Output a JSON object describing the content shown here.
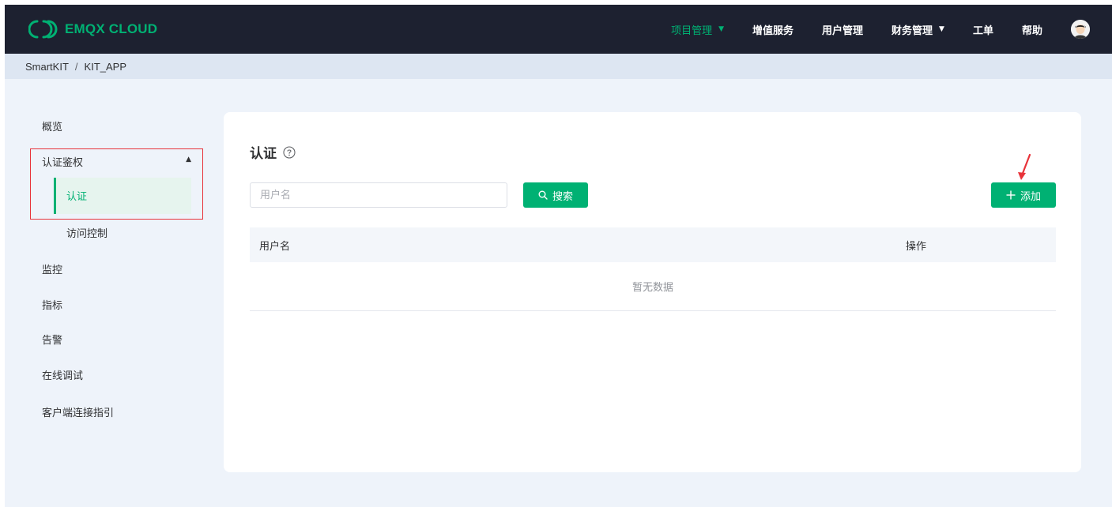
{
  "brand": {
    "name": "EMQX CLOUD",
    "color": "#00b173"
  },
  "nav": {
    "items": [
      {
        "label": "项目管理",
        "active": true,
        "dropdown": true
      },
      {
        "label": "增值服务",
        "active": false,
        "dropdown": false
      },
      {
        "label": "用户管理",
        "active": false,
        "dropdown": false
      },
      {
        "label": "财务管理",
        "active": false,
        "dropdown": true
      },
      {
        "label": "工单",
        "active": false,
        "dropdown": false
      },
      {
        "label": "帮助",
        "active": false,
        "dropdown": false
      }
    ],
    "avatar_icon": "user-avatar-icon"
  },
  "breadcrumb": {
    "project": "SmartKIT",
    "separator": "/",
    "app": "KIT_APP"
  },
  "sidebar": {
    "overview": "概览",
    "auth_group": {
      "label": "认证鉴权",
      "expanded": true,
      "children": [
        {
          "label": "认证",
          "active": true
        },
        {
          "label": "访问控制",
          "active": false
        }
      ]
    },
    "items": [
      "监控",
      "指标",
      "告警",
      "在线调试",
      "客户端连接指引"
    ]
  },
  "main": {
    "title": "认证",
    "help_icon": "question-circle-icon",
    "search": {
      "placeholder": "用户名",
      "value": "",
      "button_label": "搜索"
    },
    "add_button_label": "添加",
    "table": {
      "columns": [
        "用户名",
        "操作"
      ],
      "rows": [],
      "empty_text": "暂无数据"
    }
  },
  "colors": {
    "accent": "#00b173",
    "navbar_bg": "#1d2130",
    "annotation_red": "#e8333a"
  }
}
